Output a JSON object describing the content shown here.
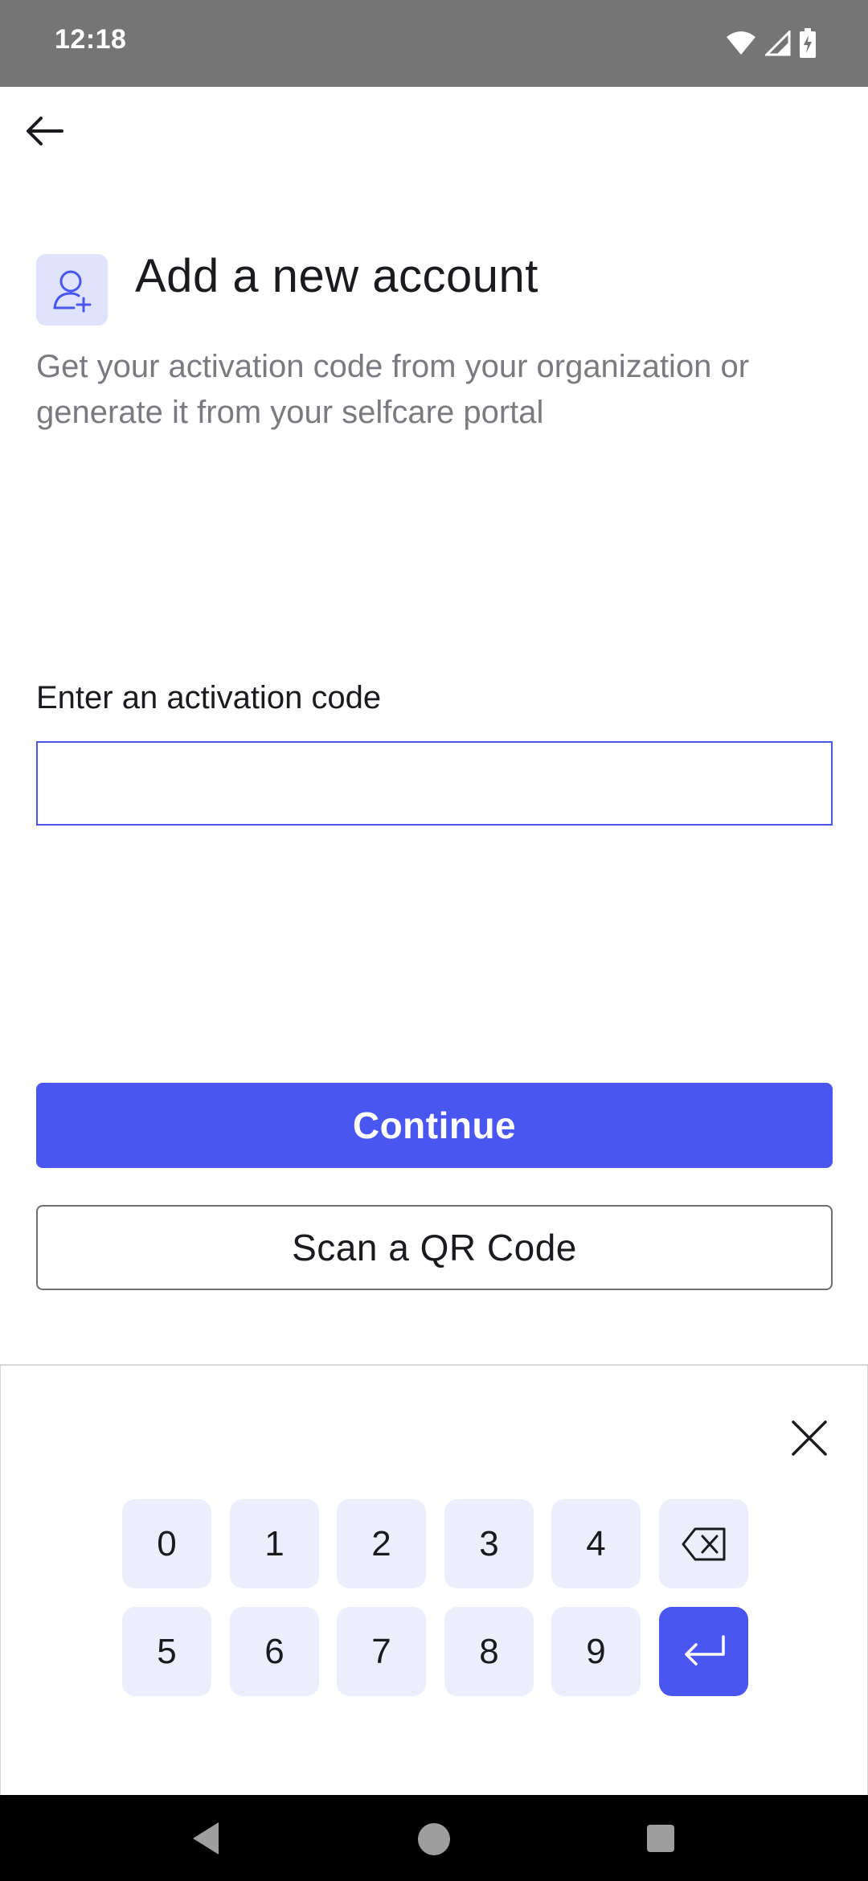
{
  "status_bar": {
    "time": "12:18",
    "icons": [
      "wifi-icon",
      "cell-signal-icon",
      "battery-icon"
    ]
  },
  "header": {
    "back_icon": "arrow-left-icon",
    "account_icon": "add-user-icon",
    "title": "Add a new account",
    "subtitle": "Get your activation code from your organization or generate it from your selfcare portal"
  },
  "form": {
    "label": "Enter an activation code",
    "value": "",
    "placeholder": ""
  },
  "actions": {
    "continue_label": "Continue",
    "scan_label": "Scan a QR Code"
  },
  "keypad": {
    "close_icon": "close-icon",
    "row1": [
      "0",
      "1",
      "2",
      "3",
      "4"
    ],
    "row2": [
      "5",
      "6",
      "7",
      "8",
      "9"
    ],
    "backspace_icon": "backspace-icon",
    "enter_icon": "enter-icon"
  },
  "nav_bar": {
    "icons": [
      "nav-back-icon",
      "nav-home-icon",
      "nav-recents-icon"
    ]
  },
  "colors": {
    "accent": "#4a56f0",
    "key_bg": "#eceefc",
    "status_bar": "#757575"
  }
}
